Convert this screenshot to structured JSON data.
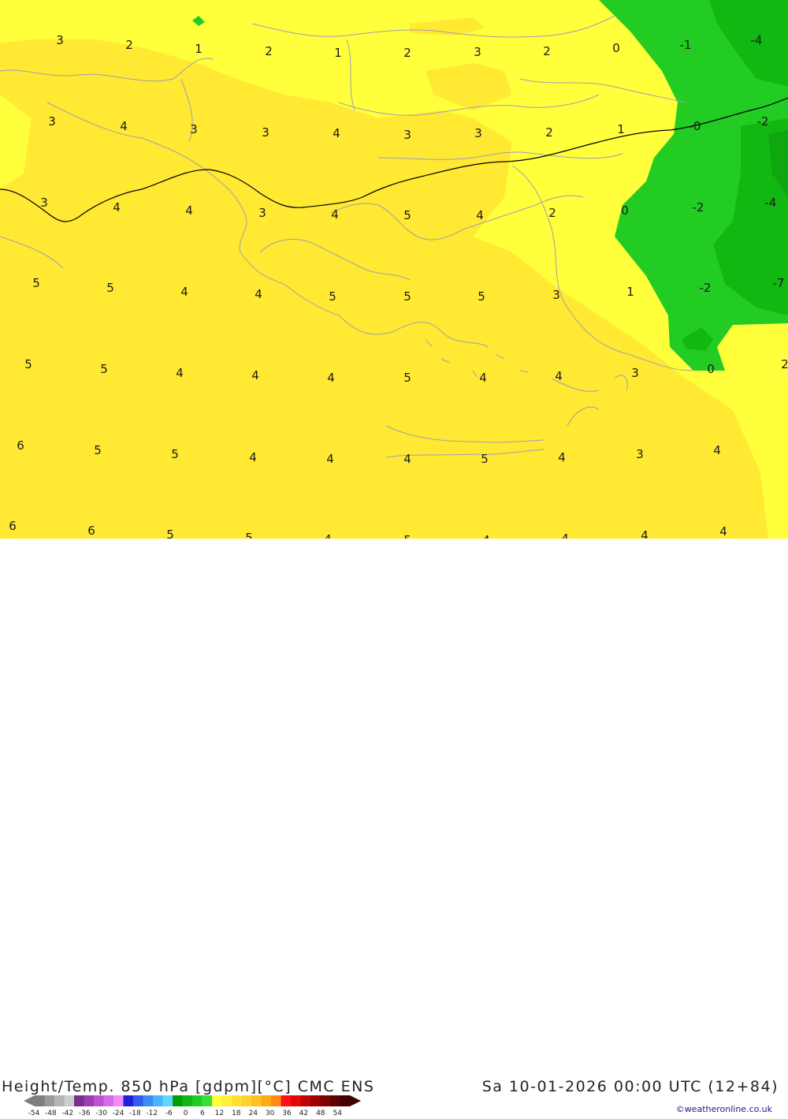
{
  "title": "Height/Temp. 850 hPa [gdpm][°C] CMC ENS",
  "datetime": "Sa 10-01-2026 00:00 UTC (12+84)",
  "credit": "©weatheronline.co.uk",
  "scale": {
    "labels": [
      "-54",
      "-48",
      "-42",
      "-36",
      "-30",
      "-24",
      "-18",
      "-12",
      "-6",
      "0",
      "6",
      "12",
      "18",
      "24",
      "30",
      "36",
      "42",
      "48",
      "54"
    ],
    "colors": [
      "#7f7f7f",
      "#9a9a9a",
      "#b4b4b4",
      "#cdcdcd",
      "#7a2f8f",
      "#9b3fb0",
      "#bb52cf",
      "#d96be8",
      "#f08df8",
      "#2020e0",
      "#2f5ff0",
      "#3c8cf6",
      "#4cb4fb",
      "#5fd8ff",
      "#00a000",
      "#12b812",
      "#22cc22",
      "#36e036",
      "#ffff3c",
      "#fff03a",
      "#ffe134",
      "#ffd22c",
      "#ffc020",
      "#ffa818",
      "#ff8c10",
      "#ff1010",
      "#e00808",
      "#c00404",
      "#a00000",
      "#820000",
      "#620000",
      "#440000"
    ]
  },
  "contour_values": [
    "3",
    "2",
    "1",
    "2",
    "1",
    "2",
    "3",
    "2",
    "0",
    "-1",
    "-4",
    "3",
    "4",
    "3",
    "3",
    "4",
    "3",
    "3",
    "2",
    "1",
    "-0",
    "-2",
    "3",
    "4",
    "4",
    "3",
    "4",
    "5",
    "4",
    "2",
    "0",
    "-2",
    "-4",
    "5",
    "5",
    "4",
    "4",
    "5",
    "5",
    "5",
    "3",
    "1",
    "-2",
    "-7",
    "5",
    "5",
    "4",
    "4",
    "4",
    "5",
    "4",
    "4",
    "3",
    "0",
    "2",
    "6",
    "5",
    "5",
    "4",
    "4",
    "4",
    "5",
    "4",
    "3",
    "4",
    "6",
    "6",
    "5",
    "5",
    "4",
    "5",
    "4",
    "4",
    "4",
    "4"
  ]
}
